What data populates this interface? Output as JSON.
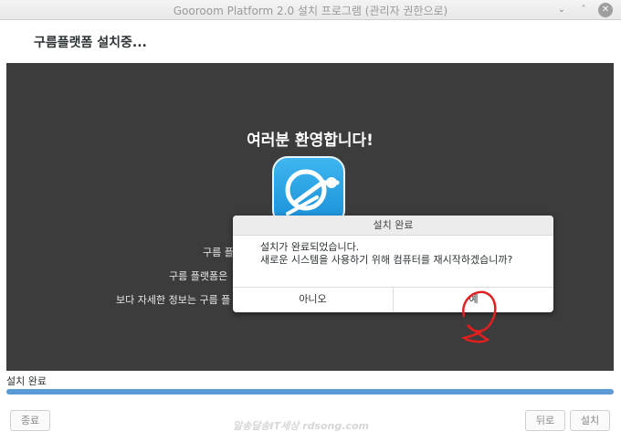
{
  "window": {
    "title": "Gooroom Platform 2.0 설치 프로그램 (관리자 권한으로)",
    "controls": {
      "minimize": "⌄",
      "maximize": "˄",
      "close": "✕"
    }
  },
  "header": {
    "label": "구름플랫폼 설치중..."
  },
  "slide": {
    "welcome": "여러분 환영합니다!",
    "line1": "구름 플",
    "line2": "구름 플랫폼은",
    "line3": "보다 자세한 정보는 구름 플"
  },
  "dialog": {
    "title": "설치 완료",
    "message_line1": "설치가 완료되었습니다.",
    "message_line2": "새로운 시스템을 사용하기 위해 컴퓨터를 재시작하겠습니까?",
    "no_label": "아니오",
    "yes_label": "예"
  },
  "progress": {
    "label": "설치 완료",
    "value": 1.0
  },
  "footer": {
    "quit_label": "종료",
    "back_label": "뒤로",
    "install_label": "설치"
  },
  "watermark": "알송달송IT세상 rdsong.com",
  "colors": {
    "accent": "#5b9bd5",
    "slide_bg": "#3c3c3c",
    "logo_blue": "#1a9be0",
    "annotation": "#e02020"
  }
}
